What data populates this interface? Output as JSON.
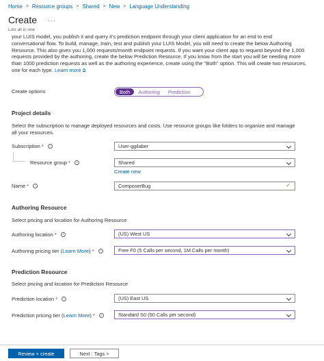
{
  "breadcrumb": [
    "Home",
    "Resource groups",
    "Shared",
    "New",
    "Language Understanding"
  ],
  "header": {
    "title": "Create",
    "more": "···",
    "subtitle": "Luis all in one"
  },
  "intro": {
    "text": "your LUIS model, you publish it and query it's prediction endpoint through your client application for an end to end conversational flow. To build, manage, train, test and publish your LUIS Model, you will need to create the below Authoring Resource. This also gives you 1,000 requests/month endpoint requests. If you want your client app to request beyond the 1,000 requests provided by the authoring, create the below Prediction Resource. If you know from the start you will be needing more than 1000 prediction requests as well as the authoring experience, create using the \"Both\" option. This will create two resources, one for each type.",
    "learn_more": "Learn more"
  },
  "create_options": {
    "label": "Create options",
    "options": [
      "Both",
      "Authoring",
      "Prediction"
    ],
    "selected": "Both"
  },
  "project_details": {
    "heading": "Project details",
    "description": "Select the subscription to manage deployed resources and costs. Use resource groups like folders to organize and manage all your resources.",
    "subscription_label": "Subscription",
    "subscription_value": "User-ggilaber",
    "resource_group_label": "Resource group",
    "resource_group_value": "Shared",
    "create_new": "Create new",
    "name_label": "Name",
    "name_value": "ComposerBug"
  },
  "authoring": {
    "heading": "Authoring Resource",
    "description": "Select pricing and location for Authoring Resource",
    "location_label": "Authoring location",
    "location_value": "(US) West US",
    "tier_label_prefix": "Authoring pricing tier (",
    "tier_learn_more": "Learn More",
    "tier_label_suffix": ")",
    "tier_value": "Free F0 (5 Calls per second, 1M Calls per month)"
  },
  "prediction": {
    "heading": "Prediction Resource",
    "description": "Select pricing and location for Prediction Resource",
    "location_label": "Prediction location",
    "location_value": "(US) East US",
    "tier_label_prefix": "Prediction pricing tier (",
    "tier_learn_more": "Learn More",
    "tier_label_suffix": ")",
    "tier_value": "Standard S0 (50 Calls per second)"
  },
  "footer": {
    "review_create": "Review + create",
    "next": "Next : Tags >"
  },
  "colors": {
    "link": "#0062ad",
    "primary_button": "#0062ad",
    "toggle_selected": "#5c2e91",
    "toggle_border": "#8764b8",
    "required": "#a4262c",
    "valid_check": "#57a300"
  }
}
